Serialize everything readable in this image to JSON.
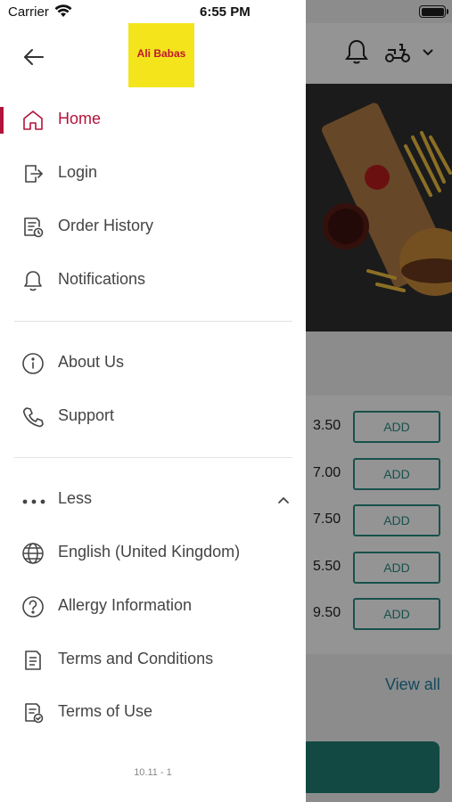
{
  "status_bar": {
    "carrier": "Carrier",
    "time": "6:55 PM"
  },
  "brand": {
    "logo_text": "Ali Babas",
    "logo_bg": "#f4e41c",
    "logo_fg": "#c0172f",
    "accent": "#b3133a"
  },
  "menu": {
    "primary": [
      {
        "label": "Home",
        "icon": "home-icon",
        "active": true
      },
      {
        "label": "Login",
        "icon": "login-icon"
      },
      {
        "label": "Order History",
        "icon": "order-history-icon"
      },
      {
        "label": "Notifications",
        "icon": "bell-icon"
      }
    ],
    "secondary": [
      {
        "label": "About Us",
        "icon": "info-icon"
      },
      {
        "label": "Support",
        "icon": "phone-icon"
      }
    ],
    "more_toggle": {
      "label": "Less",
      "icon": "more-dots-icon"
    },
    "extra": [
      {
        "label": "English (United Kingdom)",
        "icon": "globe-icon"
      },
      {
        "label": "Allergy Information",
        "icon": "question-icon"
      },
      {
        "label": "Terms and Conditions",
        "icon": "document-icon"
      },
      {
        "label": "Terms of Use",
        "icon": "document-check-icon"
      }
    ]
  },
  "version": "10.11 - 1",
  "background": {
    "prices": [
      "3.50",
      "7.00",
      "7.50",
      "5.50",
      "9.50"
    ],
    "add_label": "ADD",
    "view_all": "View all"
  }
}
